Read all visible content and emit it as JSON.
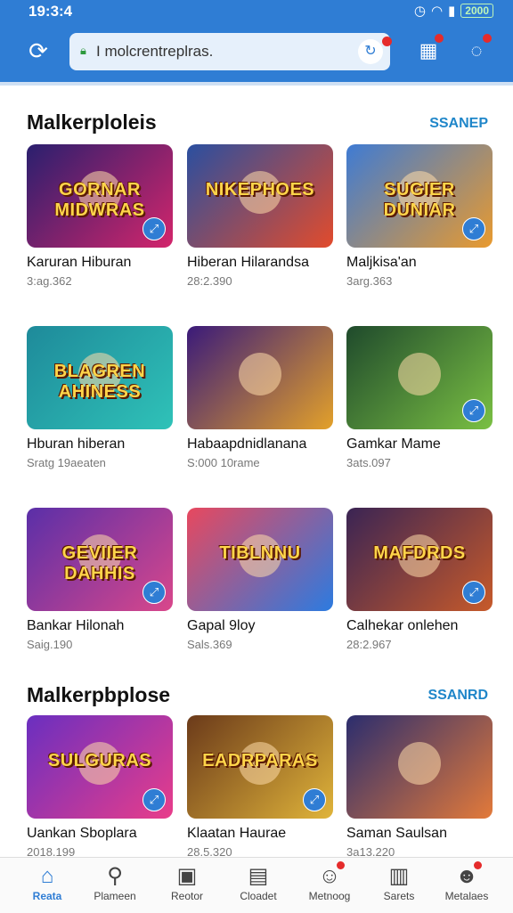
{
  "status": {
    "time": "19:3:4",
    "battery": "2000"
  },
  "browser": {
    "url": "I molcrentreplras."
  },
  "sections": [
    {
      "title": "Malkerploleis",
      "link": "SSANEP",
      "cards": [
        {
          "thumb": "GORNAR MIDWRAS",
          "title": "Karuran Hiburan",
          "meta": "3:ag.362",
          "colors": [
            "#2a1f6e",
            "#d3256b"
          ],
          "badge": true
        },
        {
          "thumb": "NIKEPHOES",
          "title": "Hiberan Hilarandsa",
          "meta": "28:2.390",
          "colors": [
            "#2a4fa0",
            "#e24b2c"
          ],
          "badge": false
        },
        {
          "thumb": "SUGIER DUNIAR",
          "title": "Maljkisa'an",
          "meta": "3arg.363",
          "colors": [
            "#3e7bd4",
            "#e99a2e"
          ],
          "badge": true
        },
        {
          "thumb": "BLAGREN AHINESS",
          "title": "Hburan hiberan",
          "meta": "Sratg 19aeaten",
          "colors": [
            "#1e8a9a",
            "#2fc2b8"
          ],
          "badge": false
        },
        {
          "thumb": "",
          "title": "Habaapdnidlanana",
          "meta": "S:000 10rame",
          "colors": [
            "#3a1a7a",
            "#e3a12a"
          ],
          "badge": false
        },
        {
          "thumb": "",
          "title": "Gamkar Mame",
          "meta": "3ats.097",
          "colors": [
            "#1f4a2c",
            "#7ac043"
          ],
          "badge": true
        },
        {
          "thumb": "GEVIIER DAHHIS",
          "title": "Bankar Hilonah",
          "meta": "Saig.190",
          "colors": [
            "#5a2fa8",
            "#d9478b"
          ],
          "badge": true
        },
        {
          "thumb": "TIBLNNU",
          "title": "Gapal 9loy",
          "meta": "Sals.369",
          "colors": [
            "#e8485e",
            "#2c7be0"
          ],
          "badge": false
        },
        {
          "thumb": "MAFDRDS",
          "title": "Calhekar onlehen",
          "meta": "28:2.967",
          "colors": [
            "#3a2454",
            "#c75a2a"
          ],
          "badge": true
        }
      ]
    },
    {
      "title": "Malkerpbplose",
      "link": "SSANRD",
      "cards": [
        {
          "thumb": "SULGURAS",
          "title": "Uankan Sboplara",
          "meta": "2018.199",
          "colors": [
            "#6a2fc0",
            "#e93d8a"
          ],
          "badge": true
        },
        {
          "thumb": "EADRPARAS",
          "title": "Klaatan Haurae",
          "meta": "28.5.320",
          "colors": [
            "#6b3a1a",
            "#e0b43a"
          ],
          "badge": true
        },
        {
          "thumb": "",
          "title": "Saman Saulsan",
          "meta": "3a13.220",
          "colors": [
            "#2b2d6e",
            "#e37a3a"
          ],
          "badge": false
        }
      ]
    }
  ],
  "bottom_nav": [
    {
      "label": "Reata",
      "icon": "home-icon",
      "glyph": "⌂"
    },
    {
      "label": "Plameen",
      "icon": "search-icon",
      "glyph": "⚲"
    },
    {
      "label": "Reotor",
      "icon": "store-icon",
      "glyph": "▣"
    },
    {
      "label": "Cloadet",
      "icon": "document-icon",
      "glyph": "▤"
    },
    {
      "label": "Metnoog",
      "icon": "controller-icon",
      "glyph": "☺"
    },
    {
      "label": "Sarets",
      "icon": "book-icon",
      "glyph": "▥"
    },
    {
      "label": "Metalaes",
      "icon": "profile-icon",
      "glyph": "☻"
    }
  ]
}
